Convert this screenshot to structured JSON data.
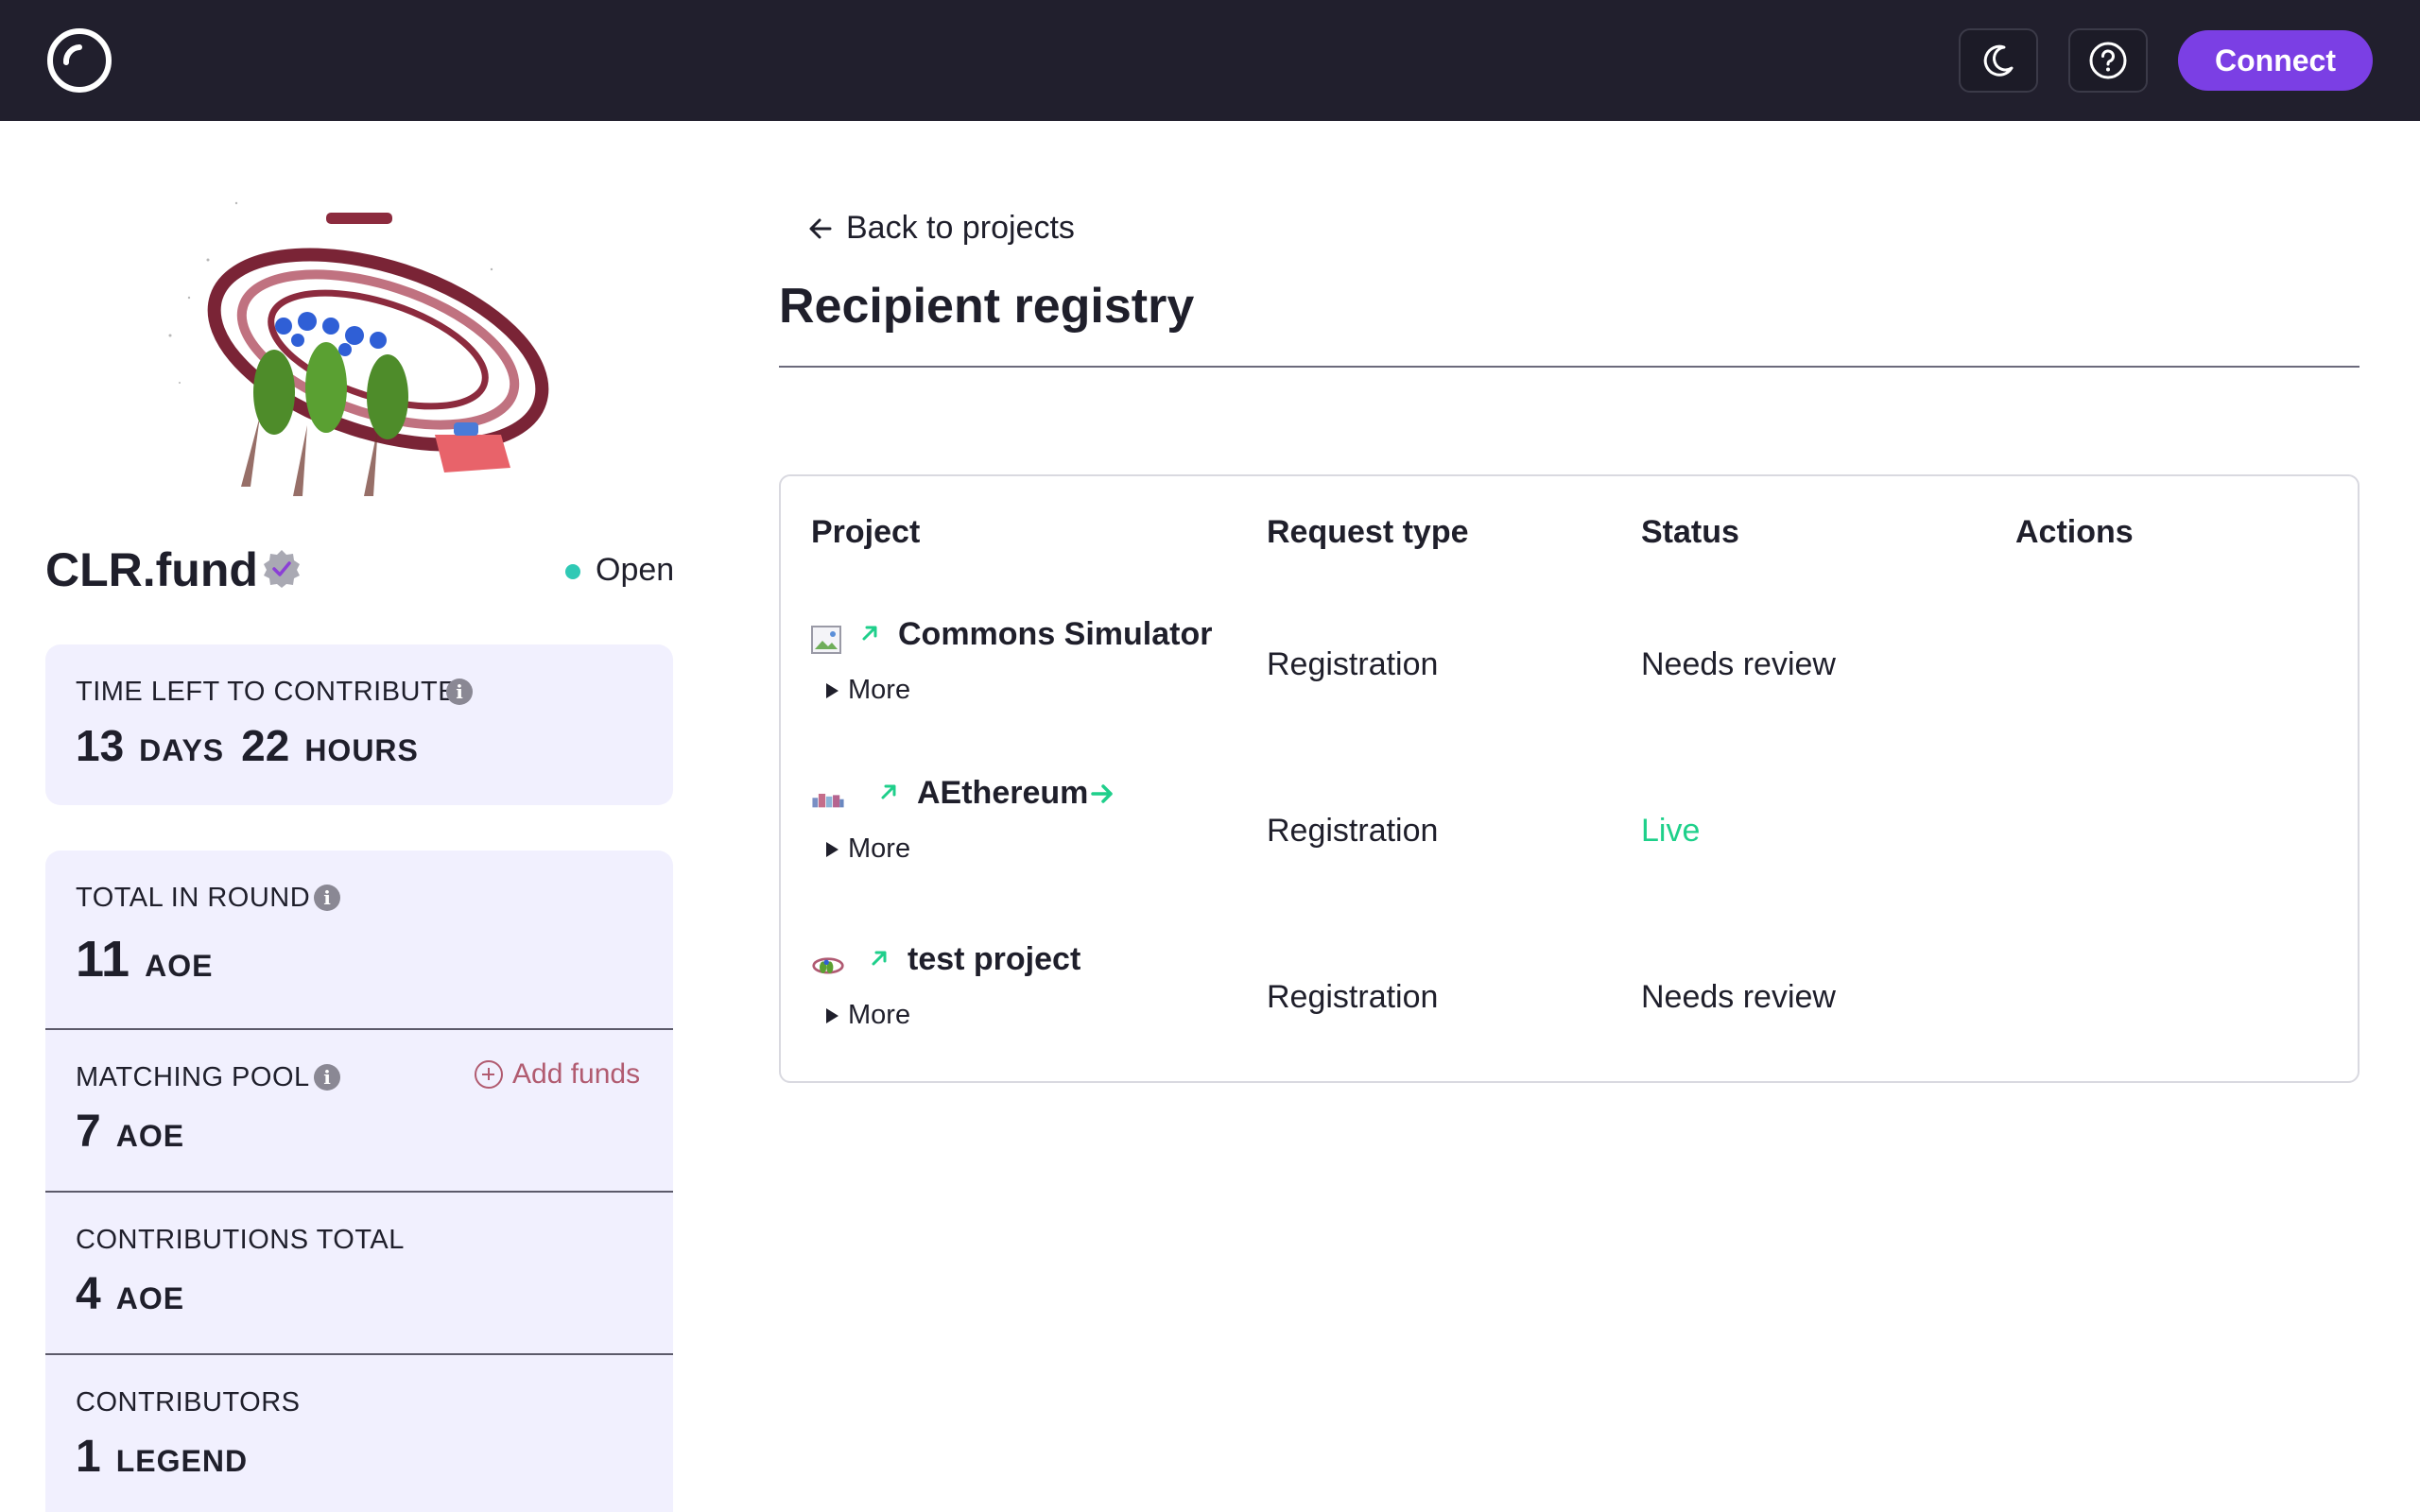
{
  "header": {
    "logo_icon": "circle-logo-icon",
    "theme_icon": "moon-icon",
    "help_icon": "question-circle-icon",
    "connect_label": "Connect"
  },
  "round": {
    "name": "CLR.fund",
    "verified_icon": "verified-badge-icon",
    "status": "Open",
    "status_color": "#2fc9b5",
    "stats": {
      "time_left": {
        "label": "TIME LEFT TO CONTRIBUTE",
        "days_value": "13",
        "days_unit": "DAYS",
        "hours_value": "22",
        "hours_unit": "HOURS"
      },
      "total_in_round": {
        "label": "TOTAL IN ROUND",
        "value": "11",
        "unit": "AOE"
      },
      "matching_pool": {
        "label": "MATCHING POOL",
        "value": "7",
        "unit": "AOE",
        "add_funds_label": "Add funds"
      },
      "contributions_total": {
        "label": "CONTRIBUTIONS TOTAL",
        "value": "4",
        "unit": "AOE"
      },
      "contributors": {
        "label": "CONTRIBUTORS",
        "value": "1",
        "unit": "LEGEND"
      }
    }
  },
  "main": {
    "back_label": "Back to projects",
    "title": "Recipient registry",
    "table": {
      "headers": {
        "project": "Project",
        "request_type": "Request type",
        "status": "Status",
        "actions": "Actions"
      },
      "more_label": "More",
      "rows": [
        {
          "name": "Commons Simulator",
          "request_type": "Registration",
          "status": "Needs review"
        },
        {
          "name": "AEthereum",
          "request_type": "Registration",
          "status": "Live"
        },
        {
          "name": "test project",
          "request_type": "Registration",
          "status": "Needs review"
        }
      ]
    }
  },
  "colors": {
    "accent": "#7b3fe4",
    "live": "#1ed08a",
    "add_funds": "#b15b70",
    "header_bg": "#211f2d",
    "card_bg": "#f1f0fe"
  }
}
